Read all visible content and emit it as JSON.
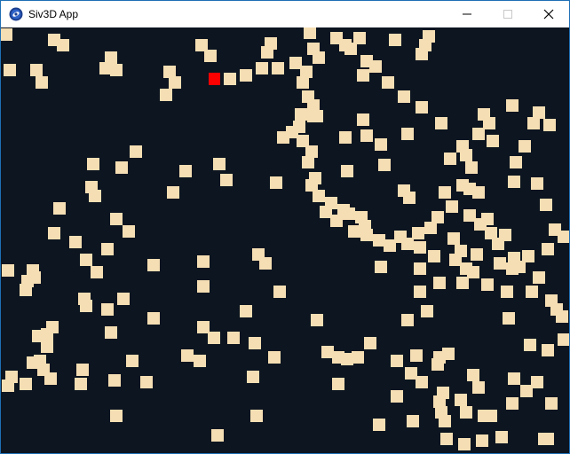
{
  "window": {
    "title": "Siv3D App",
    "icon": "siv3d-logo-icon",
    "controls": [
      "minimize-icon",
      "maximize-icon",
      "close-icon"
    ]
  },
  "scene": {
    "background_color": "#0c1520",
    "block_color": "#f5deb3",
    "player_color": "#ff0000"
  }
}
